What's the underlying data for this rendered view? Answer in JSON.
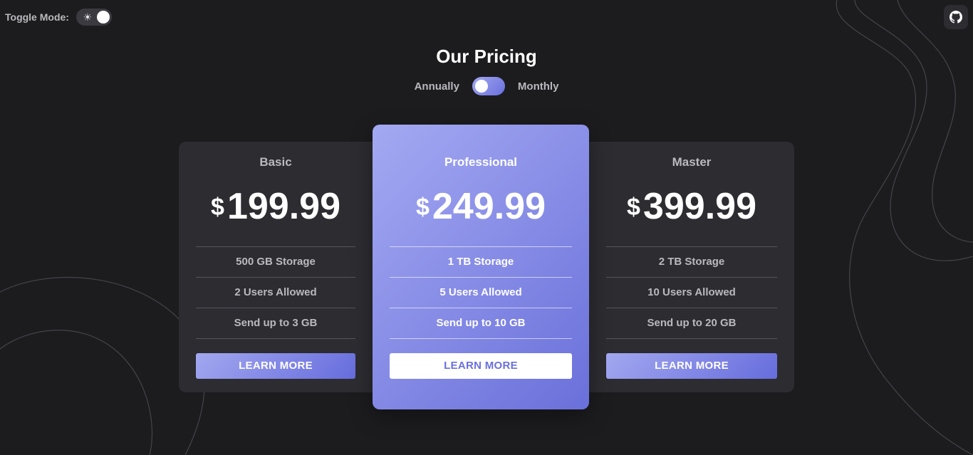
{
  "mode_toggle": {
    "label": "Toggle Mode:",
    "icon": "sun-icon",
    "state": "dark"
  },
  "github": {
    "icon": "github-icon"
  },
  "title": "Our Pricing",
  "billing": {
    "left_label": "Annually",
    "right_label": "Monthly",
    "selected": "Annually"
  },
  "plans": [
    {
      "name": "Basic",
      "currency": "$",
      "price": "199.99",
      "features": [
        "500 GB Storage",
        "2 Users Allowed",
        "Send up to 3 GB"
      ],
      "button": "LEARN MORE"
    },
    {
      "name": "Professional",
      "currency": "$",
      "price": "249.99",
      "features": [
        "1 TB Storage",
        "5 Users Allowed",
        "Send up to 10 GB"
      ],
      "button": "LEARN MORE"
    },
    {
      "name": "Master",
      "currency": "$",
      "price": "399.99",
      "features": [
        "2 TB Storage",
        "10 Users Allowed",
        "Send up to 20 GB"
      ],
      "button": "LEARN MORE"
    }
  ],
  "colors": {
    "background": "#1c1c1f",
    "card": "#2c2c31",
    "accent_start": "#a4a9f2",
    "accent_end": "#6a70da",
    "muted_text": "#b9b9be"
  }
}
